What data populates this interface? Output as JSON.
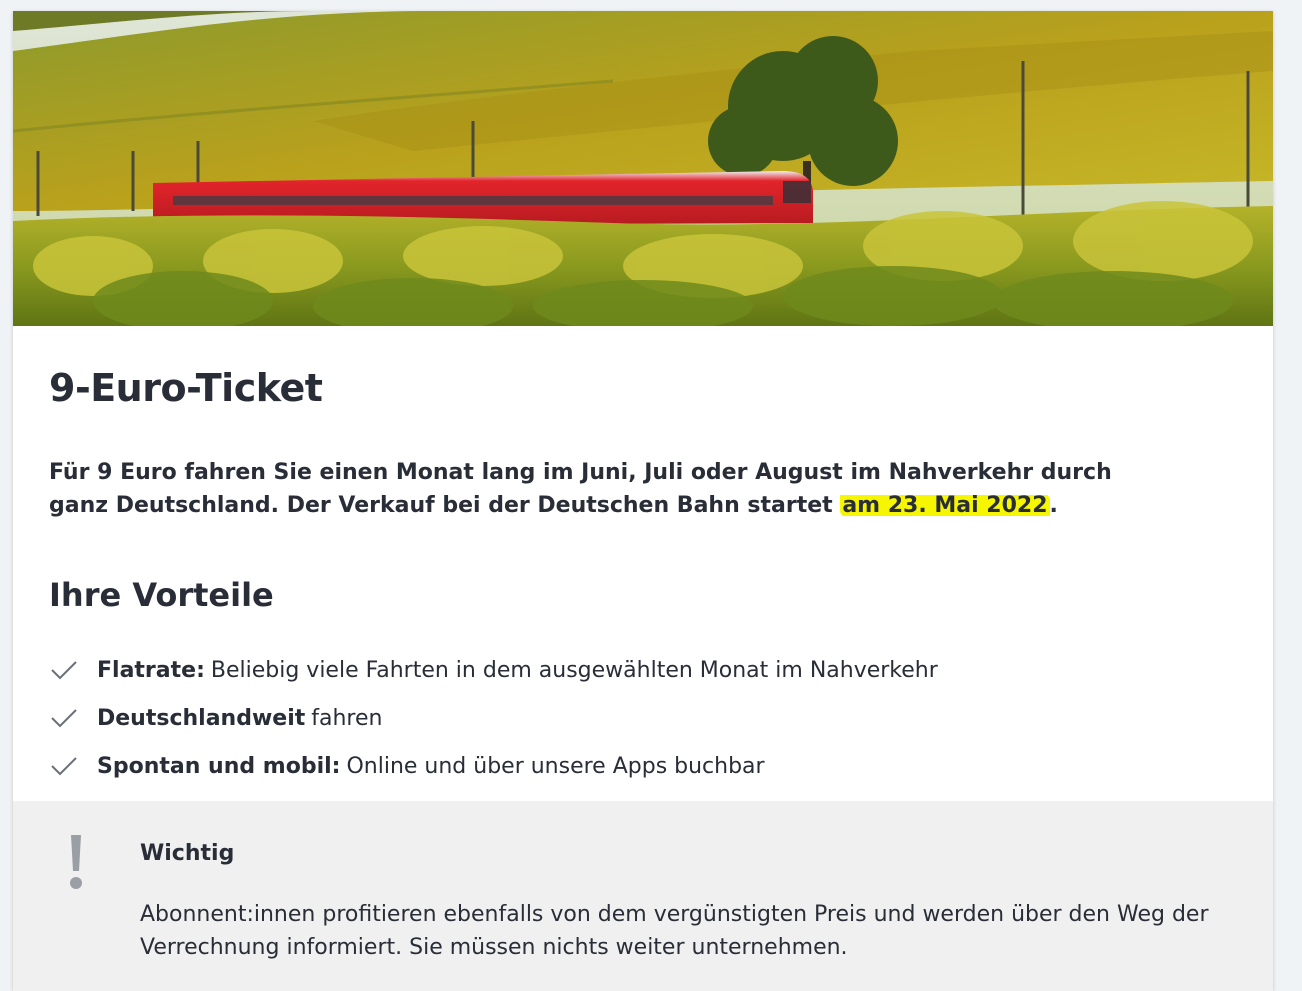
{
  "page": {
    "title": "9-Euro-Ticket",
    "intro_before": "Für 9 Euro fahren Sie einen Monat lang im Juni, Juli oder August im Nahverkehr durch ganz Deutschland. Der Verkauf bei der Deutschen Bahn startet ",
    "intro_highlight": "am 23. Mai 2022",
    "intro_after": ".",
    "highlight_color": "#f6f600"
  },
  "hero": {
    "image": "regional-train-in-vineyard",
    "train_color": "#e3242b"
  },
  "benefits": {
    "heading": "Ihre Vorteile",
    "items": [
      {
        "bold": "Flatrate:",
        "text": "Beliebig viele Fahrten in dem ausgewählten Monat im Nahverkehr",
        "icon": "check-icon"
      },
      {
        "bold": "Deutschlandweit",
        "text": "fahren",
        "icon": "check-icon"
      },
      {
        "bold": "Spontan und mobil:",
        "text": "Online und über unsere Apps buchbar",
        "icon": "check-icon"
      }
    ]
  },
  "notice": {
    "icon": "exclamation-icon",
    "title": "Wichtig",
    "text": "Abonnent:innen profitieren ebenfalls von dem vergünstigten Preis und werden über den Weg der Verrechnung informiert. Sie müssen nichts weiter unternehmen.",
    "background": "#f0f0f0"
  }
}
